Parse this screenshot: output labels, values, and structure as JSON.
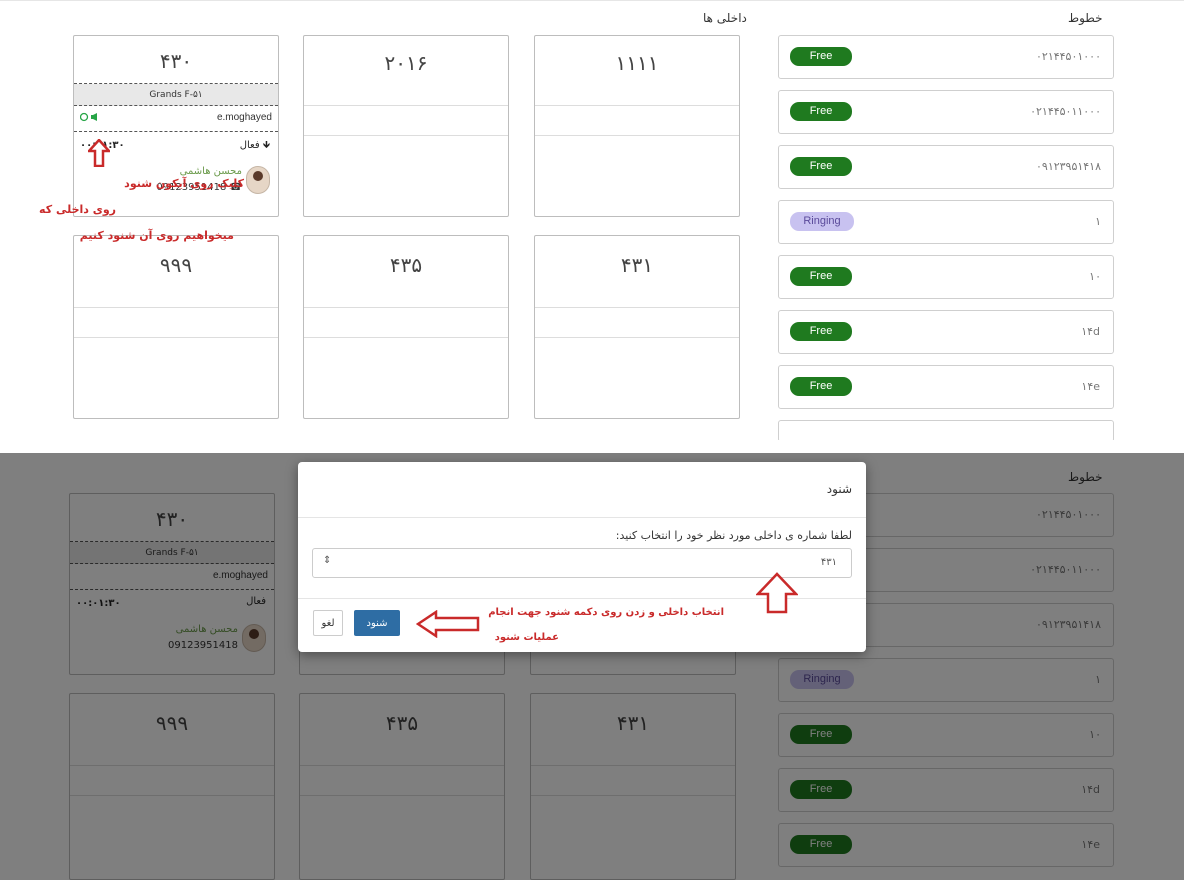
{
  "top": {
    "lines_title": "خطوط",
    "extensions_title": "داخلی ها",
    "lines": [
      {
        "status": "Free",
        "number": "۰۲۱۴۴۵۰۱۰۰۰"
      },
      {
        "status": "Free",
        "number": "۰۲۱۴۴۵۰۱۱۰۰۰"
      },
      {
        "status": "Free",
        "number": "۰۹۱۲۳۹۵۱۴۱۸"
      },
      {
        "status": "Ringing",
        "number": "۱"
      },
      {
        "status": "Free",
        "number": "۱۰"
      },
      {
        "status": "Free",
        "number": "۱۴d"
      },
      {
        "status": "Free",
        "number": "۱۴e"
      }
    ],
    "extensions": [
      {
        "number": "۴۳۰",
        "group": "Grands F-۵۱",
        "agent": "e.moghayed",
        "status": "فعال",
        "timer": "۰۰:۰۱:۳۰",
        "caller_name": "محسن هاشمی",
        "caller_phone": "09123951418"
      },
      {
        "number": "۲۰۱۶"
      },
      {
        "number": "۱۱۱۱"
      },
      {
        "number": "۹۹۹"
      },
      {
        "number": "۴۳۵"
      },
      {
        "number": "۴۳۱"
      }
    ],
    "notes": {
      "line1": "کلیک روی آیکون شنود",
      "line2": "روی داخلی که",
      "line3": "میخواهیم روی آن شنود کنیم"
    }
  },
  "modal": {
    "title": "شنود",
    "label": "لطفا شماره ی داخلی مورد نظر خود را انتخاب کنید:",
    "selected": "۴۳۱",
    "listen_button": "شنود",
    "cancel_button": "لغو",
    "note_line1": "انتخاب داخلی و زدن روی دکمه شنود جهت انجام",
    "note_line2": "عملیات شنود"
  },
  "colors": {
    "free": "#1f7a1f",
    "ringing": "#c8c2f0",
    "annotation": "#c92a2a",
    "primary_button": "#2e6da4"
  }
}
